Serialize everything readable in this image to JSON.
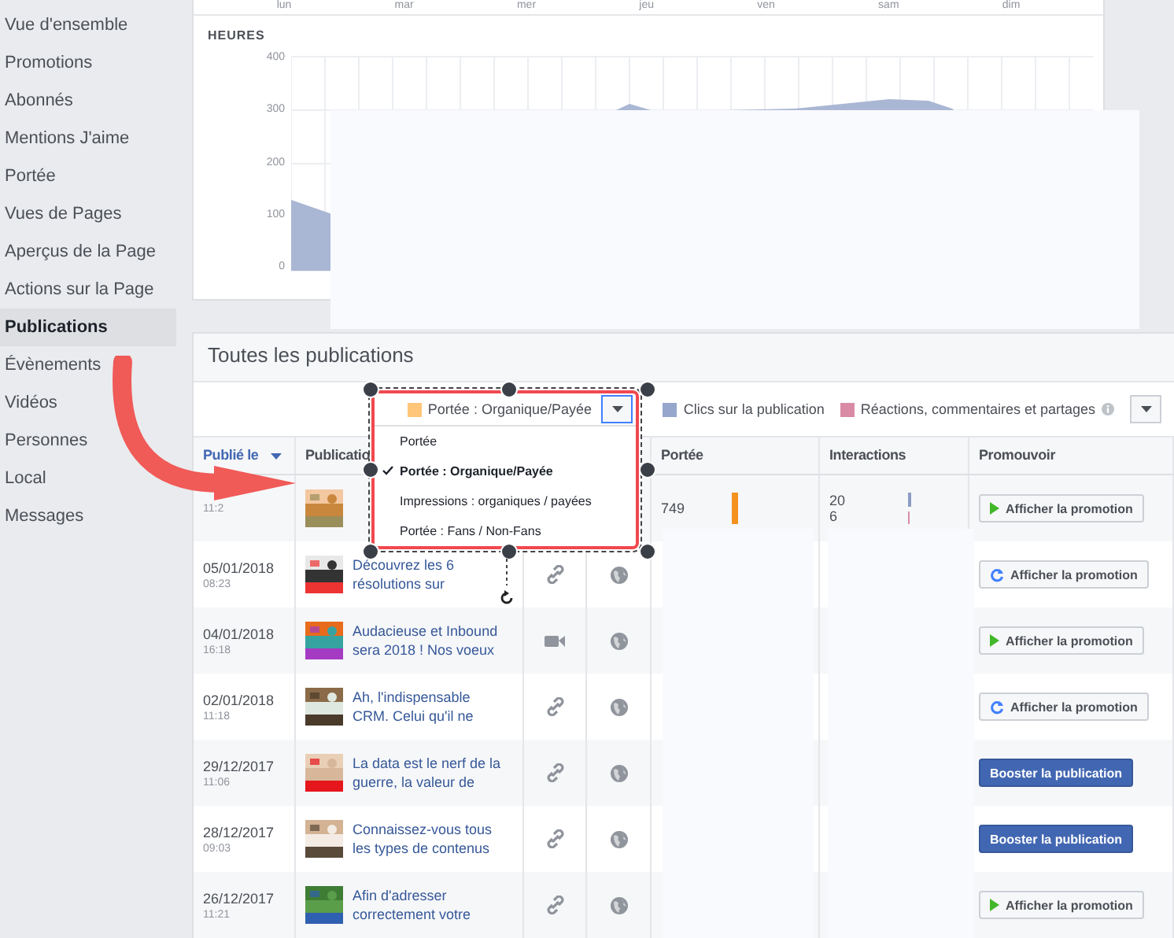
{
  "sidebar": {
    "items": [
      {
        "label": "Vue d'ensemble",
        "selected": false
      },
      {
        "label": "Promotions",
        "selected": false
      },
      {
        "label": "Abonnés",
        "selected": false
      },
      {
        "label": "Mentions J'aime",
        "selected": false
      },
      {
        "label": "Portée",
        "selected": false
      },
      {
        "label": "Vues de Pages",
        "selected": false
      },
      {
        "label": "Aperçus de la Page",
        "selected": false
      },
      {
        "label": "Actions sur la Page",
        "selected": false
      },
      {
        "label": "Publications",
        "selected": true
      },
      {
        "label": "Évènements",
        "selected": false
      },
      {
        "label": "Vidéos",
        "selected": false
      },
      {
        "label": "Personnes",
        "selected": false
      },
      {
        "label": "Local",
        "selected": false
      },
      {
        "label": "Messages",
        "selected": false
      }
    ]
  },
  "hours_chart": {
    "x_labels": [
      "lun",
      "mar",
      "mer",
      "jeu",
      "ven",
      "sam",
      "dim"
    ],
    "title": "HEURES",
    "y_labels": [
      "400",
      "300",
      "200",
      "100",
      "0"
    ]
  },
  "posts": {
    "title": "Toutes les publications",
    "legend": [
      {
        "label": "Portée : Organique/Payée",
        "color": "#ffc67a",
        "kind": "select"
      },
      {
        "label": "Clics sur la publication",
        "color": "#96a6cc",
        "kind": "plain"
      },
      {
        "label": "Réactions, commentaires et partages",
        "color": "#d98ba6",
        "kind": "info"
      }
    ],
    "metric_menu": [
      {
        "label": "Portée",
        "selected": false
      },
      {
        "label": "Portée : Organique/Payée",
        "selected": true
      },
      {
        "label": "Impressions : organiques / payées",
        "selected": false
      },
      {
        "label": "Portée : Fans / Non-Fans",
        "selected": false
      }
    ],
    "columns": [
      "Publié le",
      "Publicatio",
      "Portée",
      "Interactions",
      "Promouvoir"
    ],
    "rows": [
      {
        "time": "11:2",
        "reach": "749",
        "interactions": [
          "20",
          "6"
        ],
        "promote": {
          "kind": "play",
          "label": "Afficher la promotion"
        }
      },
      {
        "date": "05/01/2018",
        "time": "08:23",
        "title": "Découvrez les 6 résolutions sur",
        "kind": "link",
        "promote": {
          "kind": "refresh",
          "label": "Afficher la promotion"
        }
      },
      {
        "date": "04/01/2018",
        "time": "16:18",
        "title": "Audacieuse et Inbound sera 2018 ! Nos voeux",
        "kind": "video",
        "promote": {
          "kind": "play",
          "label": "Afficher la promotion"
        }
      },
      {
        "date": "02/01/2018",
        "time": "11:18",
        "title": "Ah, l'indispensable CRM. Celui qu'il ne",
        "kind": "link",
        "promote": {
          "kind": "refresh",
          "label": "Afficher la promotion"
        }
      },
      {
        "date": "29/12/2017",
        "time": "11:06",
        "title": "La data est le nerf de la guerre, la valeur de",
        "kind": "link",
        "promote": {
          "kind": "boost",
          "label": "Booster la publication"
        }
      },
      {
        "date": "28/12/2017",
        "time": "09:03",
        "title": "Connaissez-vous tous les types de contenus",
        "kind": "link",
        "promote": {
          "kind": "boost",
          "label": "Booster la publication"
        }
      },
      {
        "date": "26/12/2017",
        "time": "11:21",
        "title": "Afin d'adresser correctement votre",
        "kind": "link",
        "promote": {
          "kind": "play",
          "label": "Afficher la promotion"
        }
      }
    ]
  }
}
